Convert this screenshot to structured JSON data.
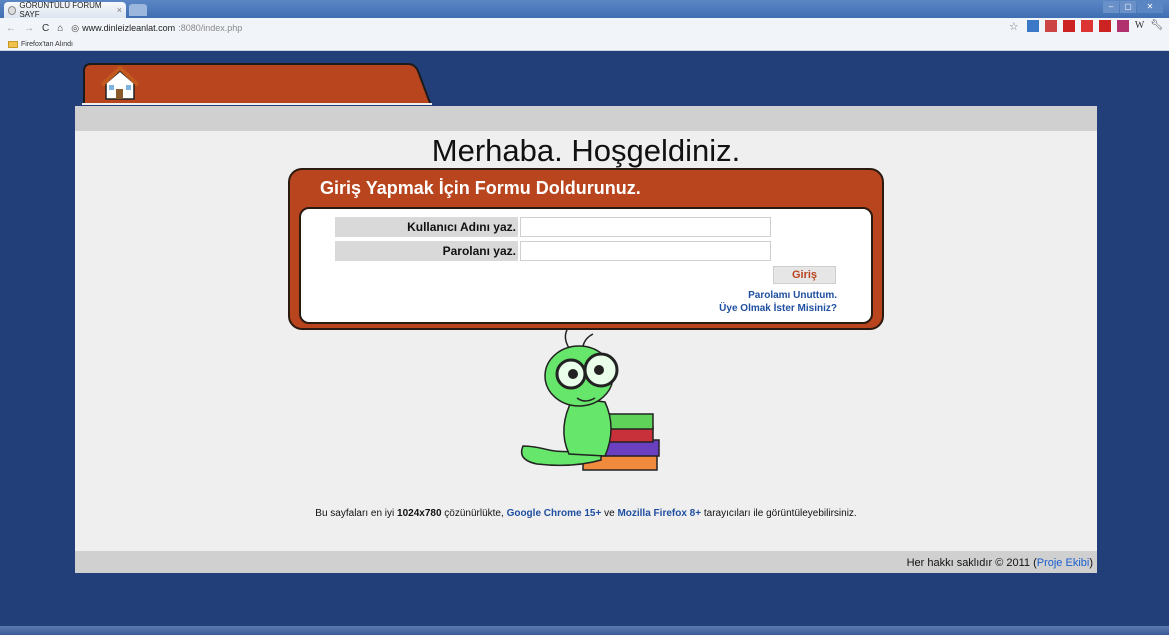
{
  "browser": {
    "tab_title": "GÖRÜNTÜLÜ FORUM SAYF",
    "tab_close": "×",
    "url_host": "www.dinleizleanlat.com",
    "url_path": ":8080/index.php",
    "bookmark_folder": "Firefox'tan Alındı",
    "window_controls": [
      "–",
      "▢",
      "✕"
    ]
  },
  "page": {
    "welcome": "Merhaba. Hoşgeldiniz.",
    "login": {
      "title": "Giriş Yapmak İçin Formu Doldurunuz.",
      "username_label": "Kullanıcı Adını yaz.",
      "password_label": "Parolanı yaz.",
      "submit_label": "Giriş",
      "forgot_link": "Parolamı Unuttum.",
      "register_link": "Üye Olmak İster Misiniz?"
    },
    "note": {
      "part1": "Bu sayfaları en iyi ",
      "resolution": "1024x780",
      "part2": " çözünürlükte, ",
      "chrome": "Google Chrome 15+",
      "part3": " ve ",
      "firefox": "Mozilla Firefox 8+",
      "part4": " tarayıcıları ile görüntüleyebilirsiniz."
    },
    "footer": {
      "text": "Her hakkı saklıdır © 2011 (",
      "link": "Proje Ekibi",
      "close": ")"
    }
  },
  "colors": {
    "background": "#223f7a",
    "accent": "#b9451f",
    "link": "#1f4fa0"
  }
}
